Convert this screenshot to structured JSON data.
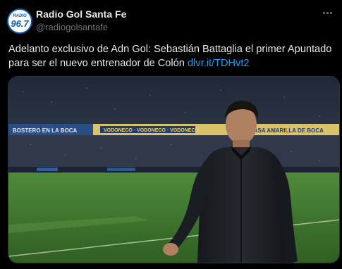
{
  "account": {
    "avatar_top": "RADIO",
    "avatar_number": "96.7",
    "display_name": "Radio Gol Santa Fe",
    "handle": "@radiogolsantafe"
  },
  "tweet": {
    "text": "Adelanto exclusivo de Adn Gol: Sebastián Battaglia el primer Apuntado para ser el nuevo entrenador de Colón ",
    "link": "dlvr.it/TDHvt2"
  },
  "media": {
    "banner_1": "CASA AMARILLA DE BOCA",
    "banner_2": "VODONECO · VODONECO · VODONECO",
    "banner_3": "BOSTERO EN LA BOCA"
  },
  "icons": {
    "more": "more-icon"
  },
  "colors": {
    "link": "#1d9bf0",
    "background": "#000000",
    "secondary_text": "#71767b"
  }
}
